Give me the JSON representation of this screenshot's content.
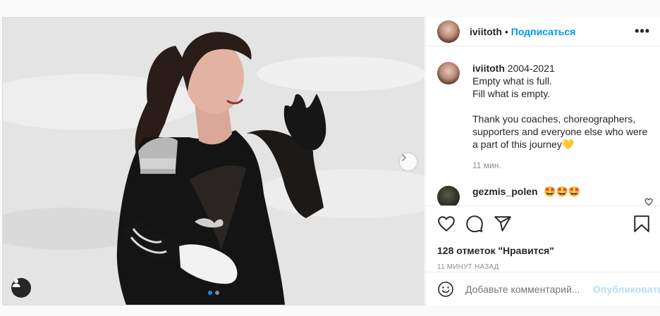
{
  "post": {
    "author": "iviitoth",
    "follow_label": "Подписаться",
    "header_separator": "•",
    "more_icon": "more-horizontal-icon",
    "caption_author": "iviitoth",
    "caption_lines": [
      "2004-2021",
      "Empty what is full.",
      "Fill what is empty.",
      "",
      "Thank you coaches, choreographers,",
      "supporters and everyone else who were",
      "a part of this journey💛"
    ],
    "caption_time": "11 мин.",
    "comments": [
      {
        "author": "gezmis_polen",
        "text": "🤩🤩🤩"
      }
    ],
    "likes_label": "128 отметок \"Нравится\"",
    "posted_time": "11 МИНУТ НАЗАД",
    "add_comment_placeholder": "Добавьте комментарий...",
    "publish_label": "Опубликовать"
  },
  "carousel": {
    "slides_count": 2,
    "active_index": 0
  },
  "colors": {
    "accent": "#0095f6",
    "publish_disabled": "#b2dffc",
    "muted": "#8e8e8e",
    "border": "#dbdbdb"
  }
}
